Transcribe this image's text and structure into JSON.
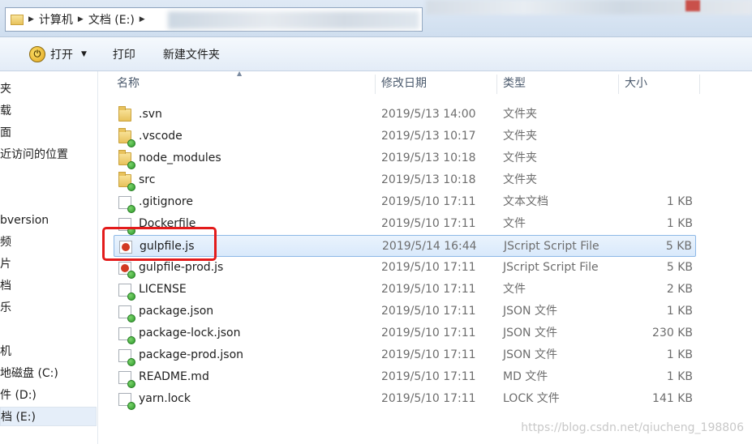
{
  "address_bar": {
    "crumbs": [
      "计算机",
      "文档 (E:)"
    ]
  },
  "toolbar": {
    "open_label": "打开",
    "print_label": "打印",
    "new_folder_label": "新建文件夹"
  },
  "nav": {
    "items": [
      "夹",
      "载",
      "面",
      "近访问的位置",
      "bversion",
      "频",
      "片",
      "档",
      "乐",
      "机",
      "地磁盘 (C:)",
      "件 (D:)",
      "档 (E:)"
    ]
  },
  "columns": {
    "name": "名称",
    "date": "修改日期",
    "type": "类型",
    "size": "大小"
  },
  "files": [
    {
      "name": ".svn",
      "date": "2019/5/13 14:00",
      "type": "文件夹",
      "size": "",
      "icon": "folder-icon",
      "badge": false
    },
    {
      "name": ".vscode",
      "date": "2019/5/13 10:17",
      "type": "文件夹",
      "size": "",
      "icon": "folder-icon",
      "badge": true
    },
    {
      "name": "node_modules",
      "date": "2019/5/13 10:18",
      "type": "文件夹",
      "size": "",
      "icon": "folder-icon",
      "badge": true
    },
    {
      "name": "src",
      "date": "2019/5/13 10:18",
      "type": "文件夹",
      "size": "",
      "icon": "folder-icon",
      "badge": true
    },
    {
      "name": ".gitignore",
      "date": "2019/5/10 17:11",
      "type": "文本文档",
      "size": "1 KB",
      "icon": "file-icon",
      "badge": true
    },
    {
      "name": "Dockerfile",
      "date": "2019/5/10 17:11",
      "type": "文件",
      "size": "1 KB",
      "icon": "file-icon",
      "badge": true
    },
    {
      "name": "gulpfile.js",
      "date": "2019/5/14 16:44",
      "type": "JScript Script File",
      "size": "5 KB",
      "icon": "jscript-icon",
      "badge": false
    },
    {
      "name": "gulpfile-prod.js",
      "date": "2019/5/10 17:11",
      "type": "JScript Script File",
      "size": "5 KB",
      "icon": "jscript-icon",
      "badge": true
    },
    {
      "name": "LICENSE",
      "date": "2019/5/10 17:11",
      "type": "文件",
      "size": "2 KB",
      "icon": "file-icon",
      "badge": true
    },
    {
      "name": "package.json",
      "date": "2019/5/10 17:11",
      "type": "JSON 文件",
      "size": "1 KB",
      "icon": "file-icon",
      "badge": true
    },
    {
      "name": "package-lock.json",
      "date": "2019/5/10 17:11",
      "type": "JSON 文件",
      "size": "230 KB",
      "icon": "file-icon",
      "badge": true
    },
    {
      "name": "package-prod.json",
      "date": "2019/5/10 17:11",
      "type": "JSON 文件",
      "size": "1 KB",
      "icon": "file-icon",
      "badge": true
    },
    {
      "name": "README.md",
      "date": "2019/5/10 17:11",
      "type": "MD 文件",
      "size": "1 KB",
      "icon": "file-icon",
      "badge": true
    },
    {
      "name": "yarn.lock",
      "date": "2019/5/10 17:11",
      "type": "LOCK 文件",
      "size": "141 KB",
      "icon": "file-icon",
      "badge": true
    }
  ],
  "selected_file": "gulpfile.js",
  "watermark": "https://blog.csdn.net/qiucheng_198806",
  "colors": {
    "selection_border": "#8db8e6",
    "highlight_red": "#e31b1b",
    "badge_green": "#2e9a2a"
  }
}
